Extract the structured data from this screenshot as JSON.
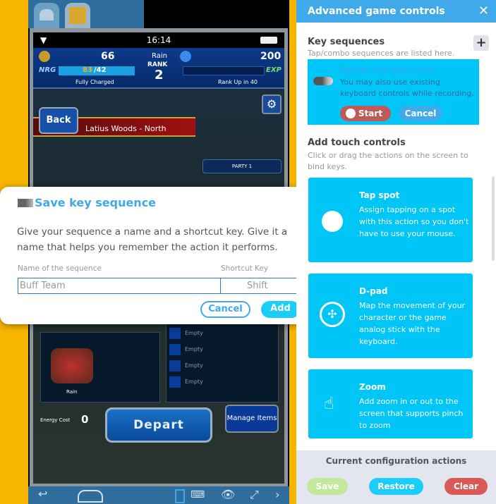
{
  "game": {
    "time": "16:14",
    "gil": "66",
    "gems": "200",
    "player": "Rain",
    "rank_label": "RANK",
    "rank": "2",
    "nrg_label": "NRG",
    "nrg": "83",
    "nrg_max": "/42",
    "fully_charged": "Fully Charged",
    "exp_label": "EXP",
    "rank_up": "Rank Up in 40",
    "back": "Back",
    "location": "Latius Woods - North",
    "party": "PARTY 1",
    "unit_name": "Rain",
    "empty": [
      "Empty",
      "Empty",
      "Empty",
      "Empty"
    ],
    "energy_cost_label": "Energy Cost",
    "energy_cost": "0",
    "depart": "Depart",
    "manage_items": "Manage Items"
  },
  "dialog": {
    "title": "Save key sequence",
    "description": "Give your sequence a name and a shortcut key. Give it a name that helps you remember the action it performs.",
    "name_label": "Name of the sequence",
    "shortcut_label": "Shortcut Key",
    "name_value": "Buff Team",
    "shortcut_value": "Shift",
    "cancel": "Cancel",
    "add": "Add"
  },
  "panel": {
    "title": "Advanced game controls",
    "key_sequences": {
      "title": "Key sequences",
      "subtitle": "Tap/combo sequences are listed here.",
      "record_title": "Record new sequence",
      "record_desc": "You may also use existing keyboard controls while recording.",
      "start": "Start",
      "cancel": "Cancel"
    },
    "touch": {
      "title": "Add touch controls",
      "subtitle": "Click or drag the actions on the screen to bind keys.",
      "cards": [
        {
          "title": "Tap spot",
          "desc": "Assign tapping on a spot with this action so you don't have to use your mouse.",
          "icon": "circle-icon"
        },
        {
          "title": "D-pad",
          "desc": "Map the movement of your character or the game analog stick with the keyboard.",
          "icon": "dpad-icon"
        },
        {
          "title": "Zoom",
          "desc": "Add zoom in or out to the screen that supports pinch to zoom",
          "icon": "pinch-icon"
        }
      ]
    },
    "footer": {
      "title": "Current configuration actions",
      "save": "Save",
      "restore": "Restore",
      "clear": "Clear"
    }
  },
  "colors": {
    "accent": "#3fa9e9",
    "card": "#00c6f7",
    "save": "#c3e89c",
    "restore": "#1ccdf7",
    "clear": "#d95a55"
  }
}
